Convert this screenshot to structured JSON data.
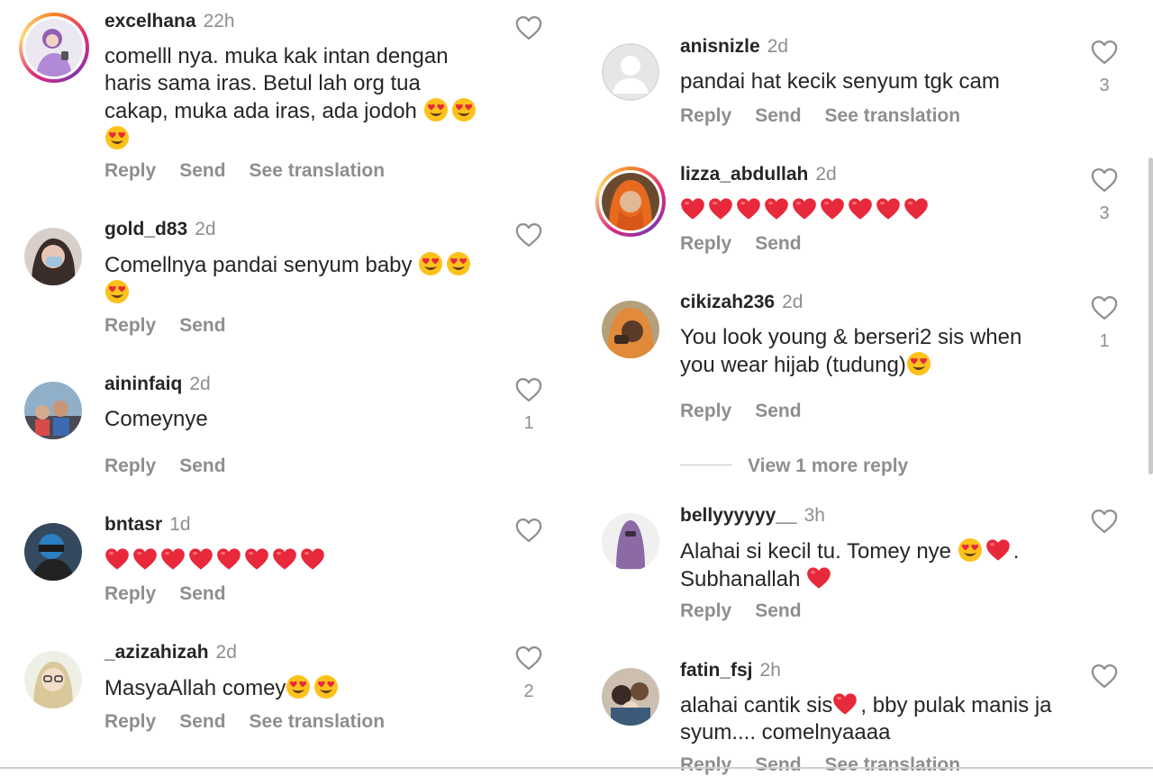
{
  "left_comments": [
    {
      "username": "excelhana",
      "time": "22h",
      "segments": [
        "comelll nya. muka kak intan dengan ",
        "haris sama iras. Betul lah org tua ",
        "cakap, muka ada iras, ada jodoh "
      ],
      "emojis": [
        "heart-eyes",
        "heart-eyes",
        "heart-eyes"
      ],
      "actions": [
        "Reply",
        "Send",
        "See translation"
      ],
      "likes": ""
    },
    {
      "username": "gold_d83",
      "time": "2d",
      "segments": [
        "Comellnya pandai senyum baby "
      ],
      "emojis": [
        "heart-eyes",
        "heart-eyes",
        "heart-eyes"
      ],
      "actions": [
        "Reply",
        "Send"
      ],
      "likes": ""
    },
    {
      "username": "aininfaiq",
      "time": "2d",
      "segments": [
        "Comeynye"
      ],
      "emojis": [],
      "actions": [
        "Reply",
        "Send"
      ],
      "likes": "1"
    },
    {
      "username": "bntasr",
      "time": "1d",
      "segments": [
        ""
      ],
      "emojis": [
        "red-heart",
        "red-heart",
        "red-heart",
        "red-heart",
        "red-heart",
        "red-heart",
        "red-heart",
        "red-heart"
      ],
      "actions": [
        "Reply",
        "Send"
      ],
      "likes": ""
    },
    {
      "username": "_azizahizah",
      "time": "2d",
      "segments": [
        "MasyaAllah comey"
      ],
      "emojis": [
        "heart-eyes",
        "heart-eyes"
      ],
      "actions": [
        "Reply",
        "Send",
        "See translation"
      ],
      "likes": "2"
    }
  ],
  "right_comments": [
    {
      "username": "anisnizle",
      "time": "2d",
      "segments": [
        "pandai hat kecik senyum tgk cam"
      ],
      "emojis": [],
      "actions": [
        "Reply",
        "Send",
        "See translation"
      ],
      "likes": "3"
    },
    {
      "username": "lizza_abdullah",
      "time": "2d",
      "segments": [
        ""
      ],
      "emojis": [
        "red-heart",
        "red-heart",
        "red-heart",
        "red-heart",
        "red-heart",
        "red-heart",
        "red-heart",
        "red-heart",
        "red-heart"
      ],
      "actions": [
        "Reply",
        "Send"
      ],
      "likes": "3"
    },
    {
      "username": "cikizah236",
      "time": "2d",
      "segments": [
        "You look young & berseri2 sis when ",
        "you wear hijab (tudung)"
      ],
      "emojis": [
        "heart-eyes"
      ],
      "actions": [
        "Reply",
        "Send"
      ],
      "likes": "1"
    },
    {
      "username": "bellyyyyyy__",
      "time": "3h",
      "segments": [
        "Alahai si kecil tu. Tomey nye ",
        ". ",
        "Subhanallah "
      ],
      "emojis": [
        "heart-eyes",
        "red-heart",
        "red-heart"
      ],
      "actions": [
        "Reply",
        "Send"
      ],
      "likes": ""
    },
    {
      "username": "fatin_fsj",
      "time": "2h",
      "segments": [
        "alahai cantik sis",
        ", bby pulak manis ja ",
        "syum.... comelnyaaaa"
      ],
      "emojis": [
        "red-heart"
      ],
      "actions": [
        "Reply",
        "Send",
        "See translation"
      ],
      "likes": ""
    }
  ],
  "view_more": "View 1 more reply",
  "colors": {
    "text": "#262626",
    "secondary": "#8e8e8e",
    "heart_red": "#ed4956",
    "emoji_yellow": "#fcc21b"
  }
}
